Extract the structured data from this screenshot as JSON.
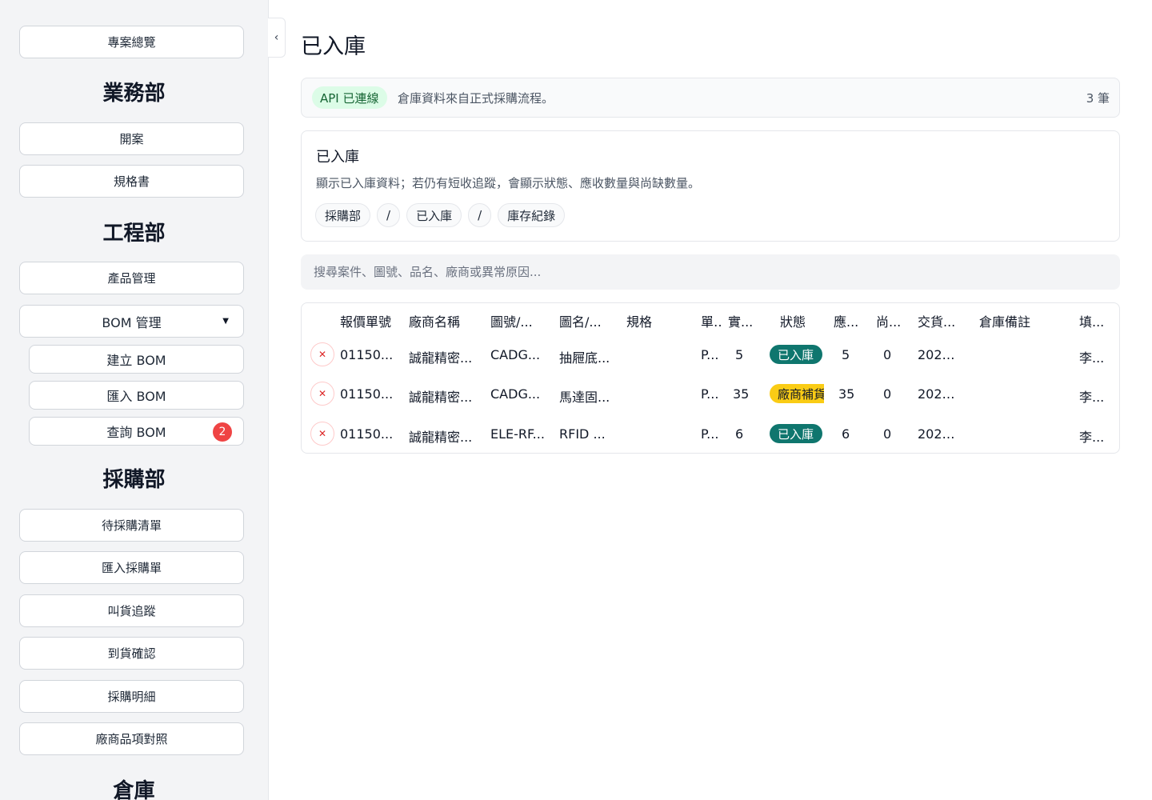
{
  "sidebar": {
    "overview": "專案總覽",
    "sections": {
      "sales": {
        "title": "業務部",
        "items": [
          "開案",
          "規格書"
        ]
      },
      "engineering": {
        "title": "工程部",
        "items": [
          "產品管理"
        ],
        "bom": {
          "label": "BOM 管理",
          "children": [
            "建立 BOM",
            "匯入 BOM",
            "查詢 BOM"
          ],
          "query_badge": "2"
        }
      },
      "purchasing": {
        "title": "採購部",
        "items": [
          "待採購清單",
          "匯入採購單",
          "叫貨追蹤",
          "到貨確認",
          "採購明細",
          "廠商品項對照"
        ]
      },
      "warehouse": {
        "title": "倉庫"
      }
    }
  },
  "colors": {
    "api_ok": "#dcfce7",
    "status_received": "#0f766e",
    "status_vendor": "#facc15",
    "badge_red": "#ef4444"
  },
  "main": {
    "title": "已入庫",
    "status": {
      "api": "API 已連線",
      "text": "倉庫資料來自正式採購流程。",
      "count": "3 筆"
    },
    "info": {
      "title": "已入庫",
      "desc": "顯示已入庫資料；若仍有短收追蹤，會顯示狀態、應收數量與尚缺數量。",
      "crumbs": [
        "採購部",
        "/",
        "已入庫",
        "/",
        "庫存紀錄"
      ]
    },
    "search_placeholder": "搜尋案件、圖號、品名、廠商或異常原因...",
    "table": {
      "headers": [
        "報價單號",
        "廠商名稱",
        "圖號/...",
        "圖名/...",
        "規格",
        "單...",
        "實...",
        "狀態",
        "應...",
        "尚...",
        "交貨...",
        "倉庫備註",
        "填..."
      ],
      "rows": [
        {
          "quote": "01150...",
          "vendor": "誠龍精密...",
          "drawing_no": "CADG...",
          "drawing_name": "抽屜底...",
          "spec": "",
          "unit": "P...",
          "actual": "5",
          "status": "已入庫",
          "status_type": "green",
          "due": "5",
          "short": "0",
          "delivery": "2026...",
          "note": "",
          "filler": "李..."
        },
        {
          "quote": "01150...",
          "vendor": "誠龍精密...",
          "drawing_no": "CADG...",
          "drawing_name": "馬達固...",
          "spec": "",
          "unit": "P...",
          "actual": "35",
          "status": "廠商補貨",
          "status_type": "yellow",
          "due": "35",
          "short": "0",
          "delivery": "2026...",
          "note": "",
          "filler": "李..."
        },
        {
          "quote": "01150...",
          "vendor": "誠龍精密...",
          "drawing_no": "ELE-RF...",
          "drawing_name": "RFID ...",
          "spec": "",
          "unit": "P...",
          "actual": "6",
          "status": "已入庫",
          "status_type": "green",
          "due": "6",
          "short": "0",
          "delivery": "2026...",
          "note": "",
          "filler": "李..."
        }
      ]
    }
  }
}
